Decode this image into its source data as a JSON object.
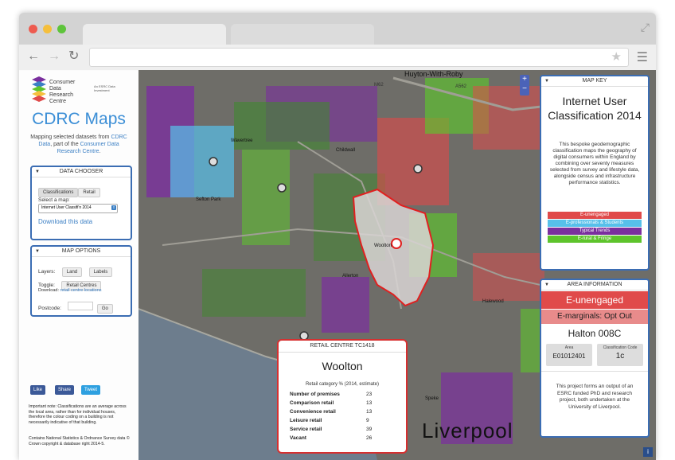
{
  "colors": {
    "accent": "#3b8ed6",
    "panel_border": "#3b6db3",
    "e_unengaged": "#e04a4a",
    "e_professionals": "#57c0ea",
    "typical_trends": "#7a2f9e",
    "e_rural": "#5ec42c",
    "e_marginals": "#e88b8b",
    "popup_border": "#d63030"
  },
  "sidebar": {
    "logo_text": "Consumer\nData\nResearch\nCentre",
    "esrc_text": "An ESRC Data Investment",
    "brand_title": "CDRC Maps",
    "desc_prefix": "Mapping selected datasets from",
    "desc_link1": "CDRC Data",
    "desc_mid": ", part of the",
    "desc_link2": "Consumer Data Research Centre",
    "desc_end": ".",
    "data_chooser": {
      "title": "DATA CHOOSER",
      "tab1": "Classifications",
      "tab2": "Retail",
      "select_label": "Select a map:",
      "select_value": "Internet User Classifi'n 2014",
      "download": "Download this data"
    },
    "map_options": {
      "title": "MAP OPTIONS",
      "layers_label": "Layers:",
      "land_btn": "Land",
      "labels_btn": "Labels",
      "toggle_label": "Toggle:",
      "retail_btn": "Retail Centres",
      "download_label": "Download:",
      "download_link": "retail centre locations",
      "postcode_label": "Postcode:",
      "go_btn": "Go"
    },
    "social": {
      "like": "Like",
      "share": "Share",
      "tweet": "Tweet"
    },
    "note": "Important note: Classifications are an average across the local area, rather than for individual houses, therefore the colour coding on a building is not necessarily indicative of that building.",
    "note_not": "not",
    "copyright": "Contains National Statistics & Ordnance Survey data © Crown copyright & database right 2014-5."
  },
  "map": {
    "zoom_in": "+",
    "zoom_out": "−",
    "labels": {
      "huyton": "Huyton-With-Roby",
      "wavertree": "Wavertree",
      "childwall": "Childwall",
      "sefton_park": "Sefton Park",
      "woolton": "Woolton",
      "allerton": "Allerton",
      "halewood": "Halewood",
      "speke": "Speke",
      "liverpool": "Liverpool",
      "m62": "M62",
      "a562": "A562"
    }
  },
  "map_key": {
    "title": "MAP KEY",
    "classification": "Internet User Classification 2014",
    "description": "This bespoke geodemographic classification maps the geography of digital consumers within England by combining over seventy measures selected from survey and lifestyle data, alongside census and infrastructure performance statistics.",
    "legend": [
      {
        "label": "E-unengaged",
        "color": "#e04a4a"
      },
      {
        "label": "E-professionals & Students",
        "color": "#57c0ea"
      },
      {
        "label": "Typical Trends",
        "color": "#7a2f9e"
      },
      {
        "label": "E-rural & Fringe",
        "color": "#5ec42c"
      }
    ]
  },
  "area_info": {
    "title": "AREA INFORMATION",
    "group": "E-unengaged",
    "subgroup": "E-marginals: Opt Out",
    "area_name": "Halton 008C",
    "area_label": "Area",
    "area_code": "E01012401",
    "class_code_label": "Classification Code",
    "class_code": "1c",
    "footer": "This project forms an output of an ESRC funded PhD and research project, both undertaken at the University of Liverpool."
  },
  "retail_popup": {
    "title": "RETAIL CENTRE TC1418",
    "name": "Woolton",
    "subtitle": "Retail category % (2014, estimate)",
    "rows": [
      {
        "label": "Number of premises",
        "value": "23"
      },
      {
        "label": "Comparison retail",
        "value": "13"
      },
      {
        "label": "Convenience retail",
        "value": "13"
      },
      {
        "label": "Leisure retail",
        "value": "9"
      },
      {
        "label": "Service retail",
        "value": "39"
      },
      {
        "label": "Vacant",
        "value": "26"
      }
    ]
  },
  "info_btn": "i"
}
